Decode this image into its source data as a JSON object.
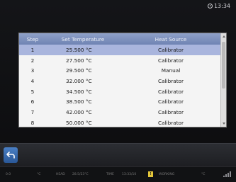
{
  "clock": {
    "time": "13:34"
  },
  "table": {
    "headers": [
      "Step",
      "Set Temperature",
      "Heat Source"
    ],
    "rows": [
      [
        "1",
        "25.500 °C",
        "Calibrator"
      ],
      [
        "2",
        "27.500 °C",
        "Calibrator"
      ],
      [
        "3",
        "29.500 °C",
        "Manual"
      ],
      [
        "4",
        "32.000 °C",
        "Calibrator"
      ],
      [
        "5",
        "34.500 °C",
        "Calibrator"
      ],
      [
        "6",
        "38.500 °C",
        "Calibrator"
      ],
      [
        "7",
        "42.000 °C",
        "Calibrator"
      ],
      [
        "8",
        "50.000 °C",
        "Calibrator"
      ]
    ],
    "selected_row": 1
  },
  "status": {
    "items": [
      "0.0",
      "°C",
      "HEAD",
      "28.5/23°C",
      "TIME",
      "13:33/10",
      "WORKING",
      "°C"
    ],
    "badge": "!"
  },
  "colors": {
    "header": "#7b8fbd",
    "selected": "#a9b5dd",
    "back_button": "#3a6db1"
  }
}
